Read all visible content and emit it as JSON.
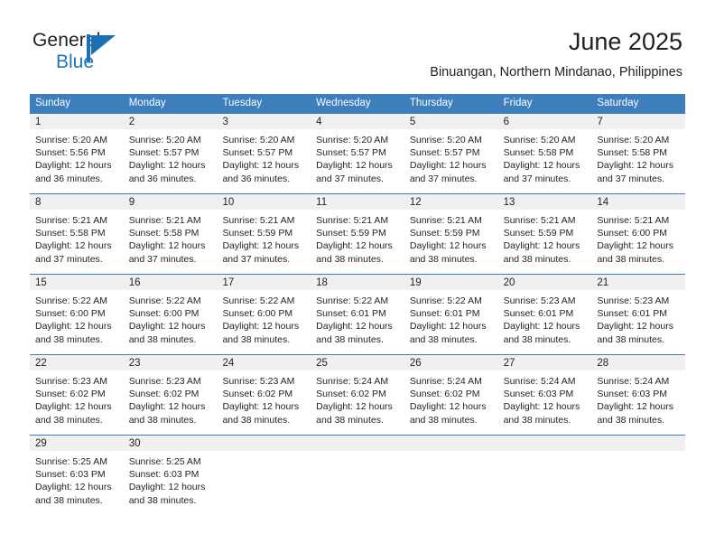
{
  "brand": {
    "line1": "General",
    "line2": "Blue",
    "mark": "triangle-logo"
  },
  "header": {
    "title": "June 2025",
    "subtitle": "Binuangan, Northern Mindanao, Philippines"
  },
  "colors": {
    "header_blue": "#3d7ebd",
    "brand_blue": "#1b75bb",
    "day_band_gray": "#f0f0f0",
    "text": "#231f20"
  },
  "weekdays": [
    "Sunday",
    "Monday",
    "Tuesday",
    "Wednesday",
    "Thursday",
    "Friday",
    "Saturday"
  ],
  "weeks": [
    [
      {
        "day": "1",
        "sunrise": "Sunrise: 5:20 AM",
        "sunset": "Sunset: 5:56 PM",
        "daylight": "Daylight: 12 hours and 36 minutes."
      },
      {
        "day": "2",
        "sunrise": "Sunrise: 5:20 AM",
        "sunset": "Sunset: 5:57 PM",
        "daylight": "Daylight: 12 hours and 36 minutes."
      },
      {
        "day": "3",
        "sunrise": "Sunrise: 5:20 AM",
        "sunset": "Sunset: 5:57 PM",
        "daylight": "Daylight: 12 hours and 36 minutes."
      },
      {
        "day": "4",
        "sunrise": "Sunrise: 5:20 AM",
        "sunset": "Sunset: 5:57 PM",
        "daylight": "Daylight: 12 hours and 37 minutes."
      },
      {
        "day": "5",
        "sunrise": "Sunrise: 5:20 AM",
        "sunset": "Sunset: 5:57 PM",
        "daylight": "Daylight: 12 hours and 37 minutes."
      },
      {
        "day": "6",
        "sunrise": "Sunrise: 5:20 AM",
        "sunset": "Sunset: 5:58 PM",
        "daylight": "Daylight: 12 hours and 37 minutes."
      },
      {
        "day": "7",
        "sunrise": "Sunrise: 5:20 AM",
        "sunset": "Sunset: 5:58 PM",
        "daylight": "Daylight: 12 hours and 37 minutes."
      }
    ],
    [
      {
        "day": "8",
        "sunrise": "Sunrise: 5:21 AM",
        "sunset": "Sunset: 5:58 PM",
        "daylight": "Daylight: 12 hours and 37 minutes."
      },
      {
        "day": "9",
        "sunrise": "Sunrise: 5:21 AM",
        "sunset": "Sunset: 5:58 PM",
        "daylight": "Daylight: 12 hours and 37 minutes."
      },
      {
        "day": "10",
        "sunrise": "Sunrise: 5:21 AM",
        "sunset": "Sunset: 5:59 PM",
        "daylight": "Daylight: 12 hours and 37 minutes."
      },
      {
        "day": "11",
        "sunrise": "Sunrise: 5:21 AM",
        "sunset": "Sunset: 5:59 PM",
        "daylight": "Daylight: 12 hours and 38 minutes."
      },
      {
        "day": "12",
        "sunrise": "Sunrise: 5:21 AM",
        "sunset": "Sunset: 5:59 PM",
        "daylight": "Daylight: 12 hours and 38 minutes."
      },
      {
        "day": "13",
        "sunrise": "Sunrise: 5:21 AM",
        "sunset": "Sunset: 5:59 PM",
        "daylight": "Daylight: 12 hours and 38 minutes."
      },
      {
        "day": "14",
        "sunrise": "Sunrise: 5:21 AM",
        "sunset": "Sunset: 6:00 PM",
        "daylight": "Daylight: 12 hours and 38 minutes."
      }
    ],
    [
      {
        "day": "15",
        "sunrise": "Sunrise: 5:22 AM",
        "sunset": "Sunset: 6:00 PM",
        "daylight": "Daylight: 12 hours and 38 minutes."
      },
      {
        "day": "16",
        "sunrise": "Sunrise: 5:22 AM",
        "sunset": "Sunset: 6:00 PM",
        "daylight": "Daylight: 12 hours and 38 minutes."
      },
      {
        "day": "17",
        "sunrise": "Sunrise: 5:22 AM",
        "sunset": "Sunset: 6:00 PM",
        "daylight": "Daylight: 12 hours and 38 minutes."
      },
      {
        "day": "18",
        "sunrise": "Sunrise: 5:22 AM",
        "sunset": "Sunset: 6:01 PM",
        "daylight": "Daylight: 12 hours and 38 minutes."
      },
      {
        "day": "19",
        "sunrise": "Sunrise: 5:22 AM",
        "sunset": "Sunset: 6:01 PM",
        "daylight": "Daylight: 12 hours and 38 minutes."
      },
      {
        "day": "20",
        "sunrise": "Sunrise: 5:23 AM",
        "sunset": "Sunset: 6:01 PM",
        "daylight": "Daylight: 12 hours and 38 minutes."
      },
      {
        "day": "21",
        "sunrise": "Sunrise: 5:23 AM",
        "sunset": "Sunset: 6:01 PM",
        "daylight": "Daylight: 12 hours and 38 minutes."
      }
    ],
    [
      {
        "day": "22",
        "sunrise": "Sunrise: 5:23 AM",
        "sunset": "Sunset: 6:02 PM",
        "daylight": "Daylight: 12 hours and 38 minutes."
      },
      {
        "day": "23",
        "sunrise": "Sunrise: 5:23 AM",
        "sunset": "Sunset: 6:02 PM",
        "daylight": "Daylight: 12 hours and 38 minutes."
      },
      {
        "day": "24",
        "sunrise": "Sunrise: 5:23 AM",
        "sunset": "Sunset: 6:02 PM",
        "daylight": "Daylight: 12 hours and 38 minutes."
      },
      {
        "day": "25",
        "sunrise": "Sunrise: 5:24 AM",
        "sunset": "Sunset: 6:02 PM",
        "daylight": "Daylight: 12 hours and 38 minutes."
      },
      {
        "day": "26",
        "sunrise": "Sunrise: 5:24 AM",
        "sunset": "Sunset: 6:02 PM",
        "daylight": "Daylight: 12 hours and 38 minutes."
      },
      {
        "day": "27",
        "sunrise": "Sunrise: 5:24 AM",
        "sunset": "Sunset: 6:03 PM",
        "daylight": "Daylight: 12 hours and 38 minutes."
      },
      {
        "day": "28",
        "sunrise": "Sunrise: 5:24 AM",
        "sunset": "Sunset: 6:03 PM",
        "daylight": "Daylight: 12 hours and 38 minutes."
      }
    ],
    [
      {
        "day": "29",
        "sunrise": "Sunrise: 5:25 AM",
        "sunset": "Sunset: 6:03 PM",
        "daylight": "Daylight: 12 hours and 38 minutes."
      },
      {
        "day": "30",
        "sunrise": "Sunrise: 5:25 AM",
        "sunset": "Sunset: 6:03 PM",
        "daylight": "Daylight: 12 hours and 38 minutes."
      },
      {
        "day": "",
        "sunrise": "",
        "sunset": "",
        "daylight": ""
      },
      {
        "day": "",
        "sunrise": "",
        "sunset": "",
        "daylight": ""
      },
      {
        "day": "",
        "sunrise": "",
        "sunset": "",
        "daylight": ""
      },
      {
        "day": "",
        "sunrise": "",
        "sunset": "",
        "daylight": ""
      },
      {
        "day": "",
        "sunrise": "",
        "sunset": "",
        "daylight": ""
      }
    ]
  ]
}
